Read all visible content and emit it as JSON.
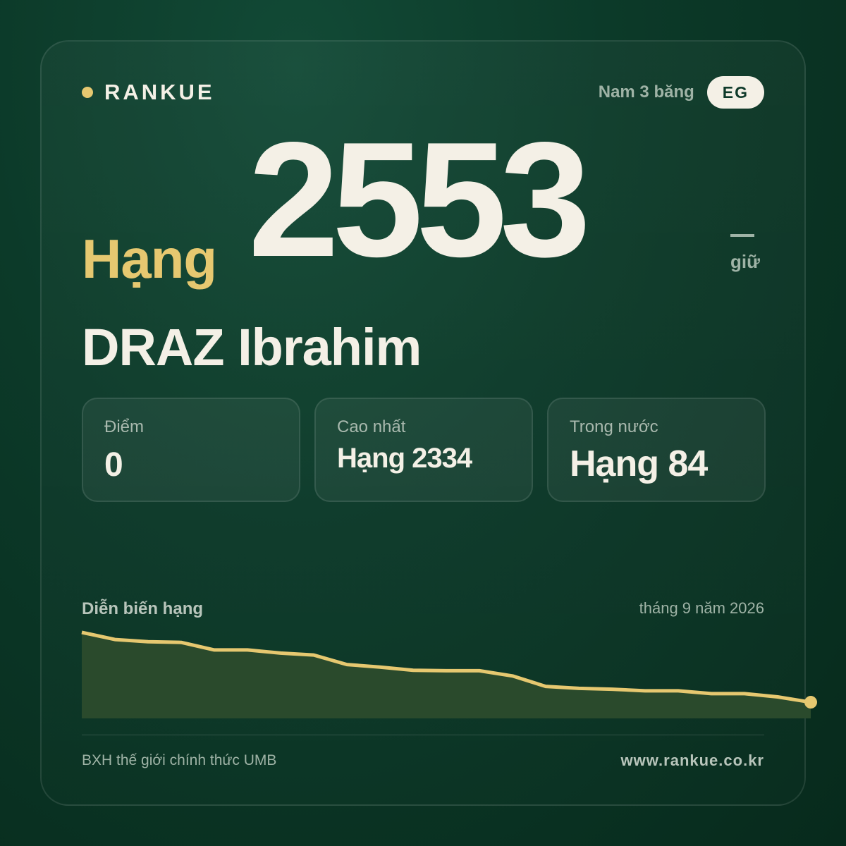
{
  "brand": {
    "name": "RANKUE"
  },
  "header": {
    "category": "Nam 3 băng",
    "country_code": "EG"
  },
  "rank": {
    "label": "Hạng",
    "number": "2553",
    "change_text": "giữ"
  },
  "player": {
    "name": "DRAZ Ibrahim"
  },
  "stats": [
    {
      "label": "Điểm",
      "value": "0"
    },
    {
      "label": "Cao nhất",
      "value": "Hạng 2334"
    },
    {
      "label": "Trong nước",
      "value": "Hạng 84"
    }
  ],
  "chart": {
    "title": "Diễn biến hạng",
    "date": "tháng 9 năm 2026"
  },
  "footer": {
    "source": "BXH thế giới chính thức UMB",
    "url": "www.rankue.co.kr"
  },
  "colors": {
    "accent": "#e6c870",
    "background": "#0c3a29",
    "text": "#f4f0e6",
    "muted": "#9fb3a6"
  },
  "chart_data": {
    "type": "area",
    "title": "Diễn biến hạng",
    "x": [
      1,
      2,
      3,
      4,
      5,
      6,
      7,
      8,
      9,
      10,
      11,
      12,
      13,
      14,
      15,
      16,
      17,
      18,
      19,
      20,
      21,
      22,
      23
    ],
    "series": [
      {
        "values": [
          3000,
          2924,
          2900,
          2893,
          2812,
          2812,
          2778,
          2758,
          2656,
          2629,
          2595,
          2590,
          2590,
          2534,
          2422,
          2401,
          2392,
          2375,
          2375,
          2345,
          2345,
          2310,
          2253
        ]
      }
    ],
    "ylim": [
      2080,
      3000
    ],
    "note": "relative rank trend, lower line = lower position value"
  }
}
